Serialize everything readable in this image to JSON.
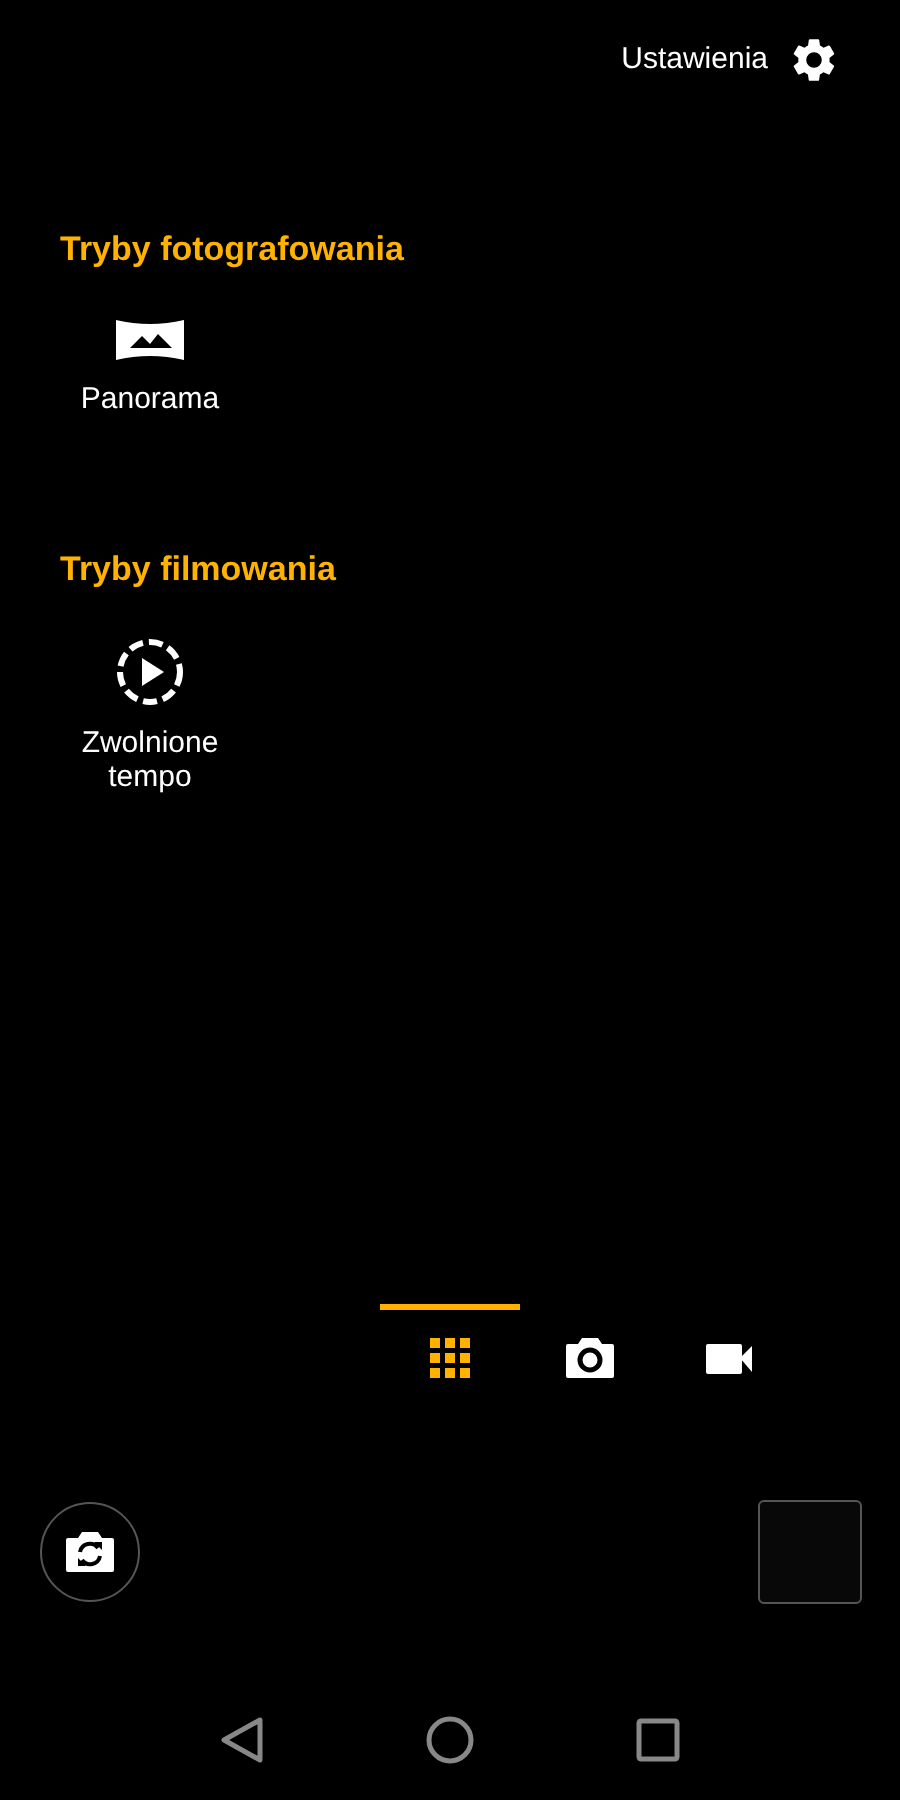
{
  "settings": {
    "label": "Ustawienia"
  },
  "sections": [
    {
      "title": "Tryby fotografowania",
      "modes": [
        {
          "kind": "panorama",
          "label": "Panorama"
        }
      ]
    },
    {
      "title": "Tryby filmowania",
      "modes": [
        {
          "kind": "slowmo",
          "label": "Zwolnione tempo"
        }
      ]
    }
  ],
  "mode_tabs": [
    {
      "kind": "grid",
      "selected": true
    },
    {
      "kind": "photo",
      "selected": false
    },
    {
      "kind": "video",
      "selected": false
    }
  ]
}
